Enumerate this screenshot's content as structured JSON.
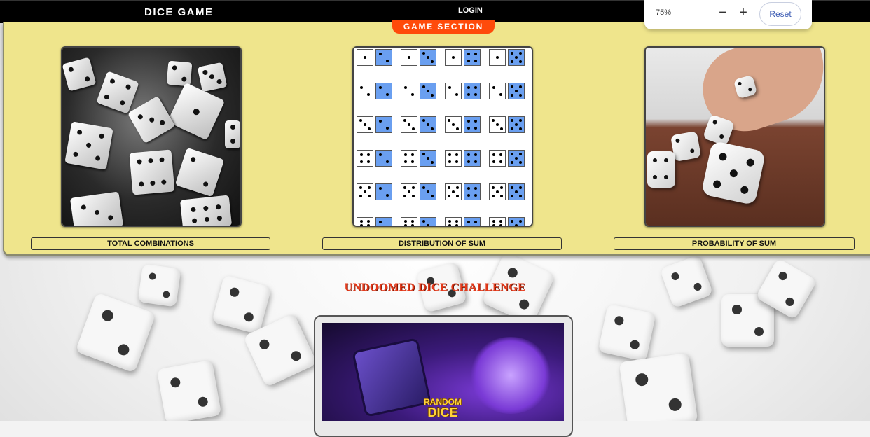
{
  "nav": {
    "brand": "DICE GAME",
    "login": "LOGIN"
  },
  "zoom": {
    "value": "75%",
    "minus": "−",
    "plus": "+",
    "reset": "Reset"
  },
  "game_section": {
    "tag": "GAME SECTION",
    "cards": [
      {
        "label": "TOTAL COMBINATIONS"
      },
      {
        "label": "DISTRIBUTION OF SUM"
      },
      {
        "label": "PROBABILITY OF SUM"
      }
    ]
  },
  "challenge": {
    "title": "UNDOOMED DICE CHALLENGE",
    "logo_line1": "RANDOM",
    "logo_line2": "DICE"
  },
  "colors": {
    "panel": "#efe58c",
    "tag": "#ff4b0a",
    "die_blue": "#6a9ff0",
    "challenge_title": "#e5391a"
  }
}
